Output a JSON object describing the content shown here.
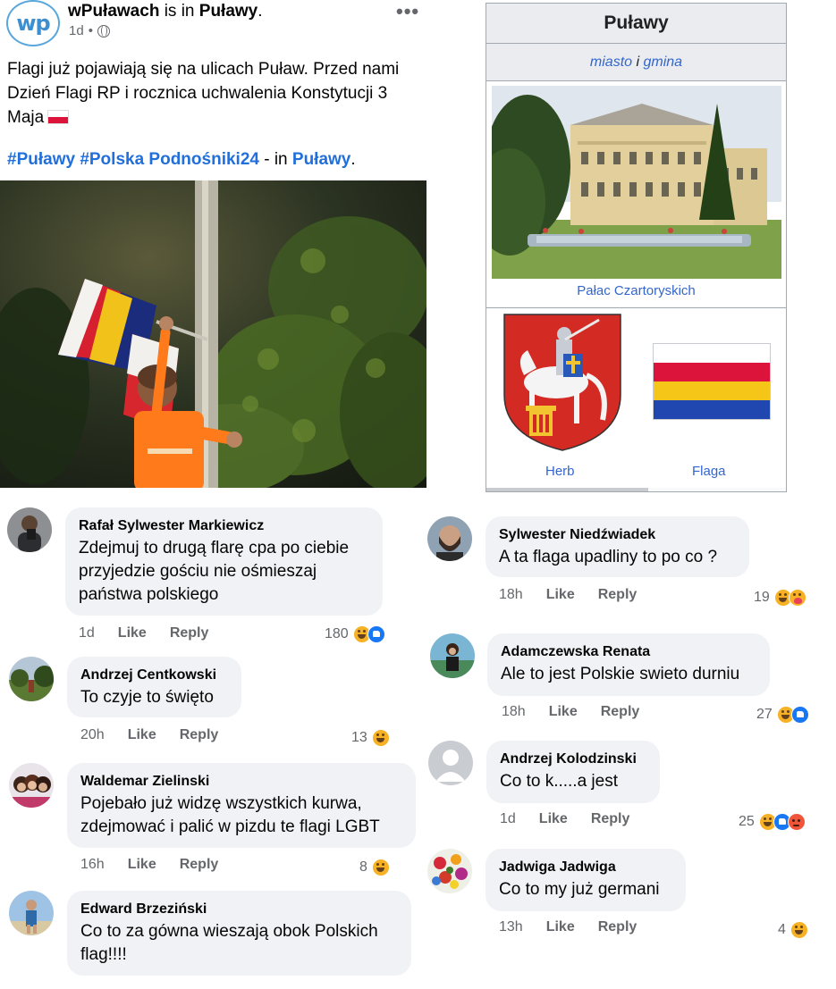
{
  "post": {
    "logo_text": "wp",
    "page_name": "wPuławach",
    "is_in": " is in ",
    "location": "Puławy",
    "period": ".",
    "time": "1d",
    "dot": "•",
    "text": "Flagi już pojawiają się na ulicach Puław. Przed nami Dzień Flagi RP i rocznica uchwalenia Konstytucji 3 Maja",
    "hashtags": "#Puławy #Polska Podnośniki24",
    "in_text": " - in ",
    "in_location": "Puławy",
    "in_period": ".",
    "more_label": "•••"
  },
  "wiki": {
    "title": "Puławy",
    "subtitle_miasto": "miasto",
    "subtitle_i": " i ",
    "subtitle_gmina": "gmina",
    "photo_caption": "Pałac Czartoryskich",
    "herb_label": "Herb",
    "flag_label": "Flaga",
    "flag_colors": [
      "#ffffff",
      "#dc143c",
      "#f5c518",
      "#2047b0"
    ]
  },
  "comments_left": [
    {
      "name": "Rafał Sylwester Markiewicz",
      "text": "Zdejmuj to drugą flarę cpa po ciebie przyjedzie gościu nie ośmieszaj państwa polskiego",
      "time": "1d",
      "like": "Like",
      "reply": "Reply",
      "count": "180",
      "reactions": [
        "haha",
        "like"
      ]
    },
    {
      "name": "Andrzej Centkowski",
      "text": "To czyje to święto",
      "time": "20h",
      "like": "Like",
      "reply": "Reply",
      "count": "13",
      "reactions": [
        "haha"
      ]
    },
    {
      "name": "Waldemar Zielinski",
      "text": "Pojebało już widzę wszystkich kurwa, zdejmować i palić w pizdu te flagi LGBT",
      "time": "16h",
      "like": "Like",
      "reply": "Reply",
      "count": "8",
      "reactions": [
        "haha"
      ]
    },
    {
      "name": "Edward Brzeziński",
      "text": "Co to za gówna wieszają obok Polskich flag!!!!",
      "time": "",
      "like": "",
      "reply": "",
      "count": "",
      "reactions": []
    }
  ],
  "comments_right": [
    {
      "name": "Sylwester Niedźwiadek",
      "text": "A ta flaga upadliny to po co ?",
      "time": "18h",
      "like": "Like",
      "reply": "Reply",
      "count": "19",
      "reactions": [
        "haha",
        "care"
      ]
    },
    {
      "name": "Adamczewska Renata",
      "text": "Ale to jest Polskie swieto durniu",
      "time": "18h",
      "like": "Like",
      "reply": "Reply",
      "count": "27",
      "reactions": [
        "haha",
        "like"
      ]
    },
    {
      "name": "Andrzej Kolodzinski",
      "text": "Co to k.....a jest",
      "time": "1d",
      "like": "Like",
      "reply": "Reply",
      "count": "25",
      "reactions": [
        "haha",
        "like",
        "angry"
      ]
    },
    {
      "name": "Jadwiga Jadwiga",
      "text": "Co to my już germani",
      "time": "13h",
      "like": "Like",
      "reply": "Reply",
      "count": "4",
      "reactions": [
        "haha"
      ]
    }
  ]
}
